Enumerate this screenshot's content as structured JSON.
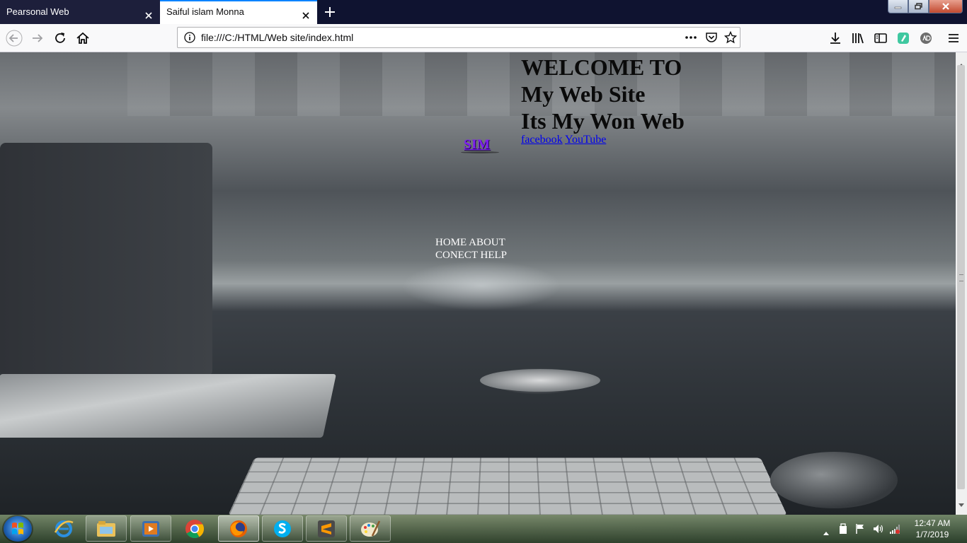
{
  "browser": {
    "tabs": [
      {
        "title": "Pearsonal Web",
        "active": false
      },
      {
        "title": "Saiful islam Monna",
        "active": true
      }
    ],
    "url": "file:///C:/HTML/Web site/index.html",
    "accent_color": "#0a84ff"
  },
  "page": {
    "heading_lines": [
      "WELCOME TO",
      "My Web Site",
      "Its My Won Web"
    ],
    "links": [
      {
        "label": "facebook"
      },
      {
        "label": "YouTube"
      }
    ],
    "logo_text": "SIM",
    "menu_items": [
      "HOME",
      "ABOUT",
      "CONECT",
      "HELP"
    ]
  },
  "taskbar": {
    "apps": [
      "internet-explorer",
      "windows-explorer",
      "media-player",
      "chrome",
      "firefox",
      "skype",
      "sublime-text",
      "paint"
    ],
    "active_app": "firefox",
    "clock_time": "12:47 AM",
    "clock_date": "1/7/2019"
  }
}
